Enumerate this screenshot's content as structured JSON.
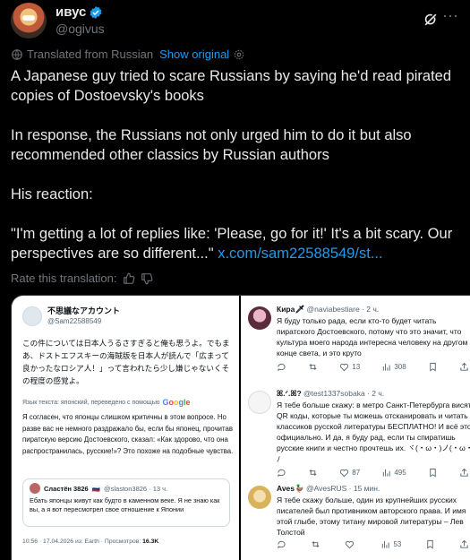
{
  "tweet": {
    "display_name": "ивус",
    "handle": "@ogivus",
    "translated_label": "Translated from Russian",
    "show_original": "Show original",
    "paragraphs": [
      "A Japanese guy tried to scare Russians by saying he'd read pirated copies of Dostoevsky's books",
      "In response, the Russians not only urged him to do it but also recommended other classics by Russian authors",
      "His reaction:"
    ],
    "quote_text": "\"I'm getting a lot of replies like: 'Please, go for it!' It's a bit scary. Our perspectives are so different...\"",
    "link": "x.com/sam22588549/st...",
    "rate_label": "Rate this translation:"
  },
  "screenshot_left": {
    "name": "不思議なアカウント",
    "handle": "@Sam22588549",
    "jp_text": "この件については日本人うるさすぎると俺も思うよ。でもまあ、ドストエフスキーの海賊版を日本人が読んで「広まって良かったなロシア人！」って言われたら少し嫌じゃないくその程度の感覚よ。",
    "translate_note": "Язык текста: японский, переведено с помощью",
    "google": "Google",
    "ru_text": "Я согласен, что японцы слишком критичны в этом вопросе. Но разве вас не немного раздражало бы, если бы японец, прочитав пиратскую версию Достоевского, сказал: «Как здорово, что она распространилась, русские!»? Это похоже на подобные чувства.",
    "quote": {
      "name": "Сластён 3826",
      "flag": "🇷🇺",
      "handle": "@slaston3826 · 13 ч.",
      "text": "Ебать японцы живут как будто в каменном веке. Я не знаю как вы, а я вот пересмотрел свое отношение к Японии"
    },
    "meta": "10:56 · 17.04.2026 из: Earth · Просмотров:",
    "views": "16.3K"
  },
  "screenshot_right": {
    "replies": [
      {
        "name": "Кира🗡",
        "handle": "@naviabestiare · 2 ч.",
        "lines": [
          "Я буду только рада, если кто-то будет читать",
          "пиратского Достоевского, потому что это значит, что",
          "культура моего народа интересна человеку на другом",
          "конце света, и это круто"
        ],
        "likes": "13",
        "views": "308"
      },
      {
        "name": "ꕤ.ᐟ.ꕤ?",
        "handle": "@test1337sobaka · 2 ч.",
        "lines": [
          "Я тебе больше скажу: в метро Санкт-Петербурга висят",
          "QR коды, которые ты можешь отсканировать и читать",
          "классиков русской литературы БЕСПЛАТНО! И всё это",
          "официально. И да, я буду рад, если ты спиратишь",
          "русские книги и честно прочтешь их. ヾ(・ω・)ノ(・ω・",
          "ﾉ"
        ],
        "likes": "87",
        "views": "495"
      },
      {
        "name": "Aves🦆",
        "handle": "@AvesRUS · 15 мин.",
        "lines": [
          "Я тебе скажу больше, один из крупнейших русских",
          "писателей был противником авторского права. И имя",
          "этой глыбе, этому титану мировой литературы – Лев",
          "Толстой"
        ],
        "likes": "",
        "views": "53"
      }
    ]
  }
}
